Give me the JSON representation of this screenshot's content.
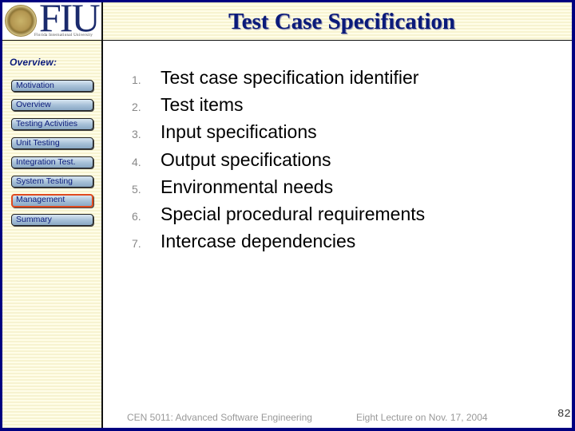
{
  "header": {
    "logo_text": "FIU",
    "logo_subtext": "Florida International University",
    "title": "Test Case Specification"
  },
  "sidebar": {
    "section_label": "Overview:",
    "items": [
      {
        "label": "Motivation",
        "active": false
      },
      {
        "label": "Overview",
        "active": false
      },
      {
        "label": "Testing Activities",
        "active": false
      },
      {
        "label": "Unit Testing",
        "active": false
      },
      {
        "label": "Integration Test.",
        "active": false
      },
      {
        "label": "System Testing",
        "active": false
      },
      {
        "label": "Management",
        "active": true
      },
      {
        "label": "Summary",
        "active": false
      }
    ],
    "active_color": "#e04a1e"
  },
  "main": {
    "list": [
      {
        "num": "1.",
        "text": "Test case specification identifier"
      },
      {
        "num": "2.",
        "text": "Test items"
      },
      {
        "num": "3.",
        "text": "Input specifications"
      },
      {
        "num": "4.",
        "text": "Output specifications"
      },
      {
        "num": "5.",
        "text": "Environmental needs"
      },
      {
        "num": "6.",
        "text": "Special procedural requirements"
      },
      {
        "num": "7.",
        "text": "Intercase dependencies"
      }
    ]
  },
  "footer": {
    "course": "CEN 5011: Advanced Software Engineering",
    "lecture": "Eight Lecture on Nov. 17, 2004",
    "page_number": "82"
  },
  "colors": {
    "frame": "#000080",
    "title": "#0a1a7a",
    "stripe_light": "#fffde8",
    "stripe_dark": "#f7f3d0"
  }
}
